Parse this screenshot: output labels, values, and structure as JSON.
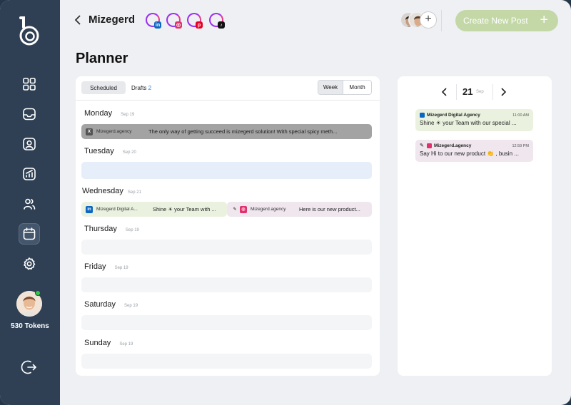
{
  "header": {
    "account_name": "Mizegerd",
    "socials": [
      {
        "icon": "linkedin-icon",
        "color": "#0a66c2",
        "glyph": "in"
      },
      {
        "icon": "instagram-icon",
        "color": "#e1306c",
        "glyph": "◎"
      },
      {
        "icon": "pinterest-icon",
        "color": "#e60023",
        "glyph": "p"
      },
      {
        "icon": "tiktok-icon",
        "color": "#111111",
        "glyph": "♪"
      }
    ],
    "create_button": "Create New Post",
    "create_plus": "+",
    "team_plus": "+"
  },
  "sidebar": {
    "tokens": "530 Tokens",
    "items": [
      "dashboard",
      "inbox",
      "profile",
      "analytics",
      "team",
      "planner",
      "settings"
    ],
    "active": "planner"
  },
  "page": {
    "title": "Planner"
  },
  "planner": {
    "tabs": {
      "scheduled": "Scheduled",
      "drafts": "Drafts",
      "drafts_count": "2"
    },
    "view": {
      "week": "Week",
      "month": "Month",
      "selected": "Week"
    },
    "days": [
      {
        "name": "Monday",
        "date": "Sep 19"
      },
      {
        "name": "Tuesday",
        "date": "Sep 20"
      },
      {
        "name": "Wednesday",
        "date": "Sep 21"
      },
      {
        "name": "Thursday",
        "date": "Sep 19"
      },
      {
        "name": "Friday",
        "date": "Sep 19"
      },
      {
        "name": "Saturday",
        "date": "Sep 19"
      },
      {
        "name": "Sunday",
        "date": "Sep 19"
      }
    ],
    "posts": {
      "monday": {
        "icon": "x-icon",
        "account": "Mizegerd.agency",
        "text": "The only way of getting succeed is mizegerd solution! With special spicy meth..."
      },
      "wed1": {
        "icon": "linkedin-icon",
        "account": "Mizegerd Digital A...",
        "text": "Shine ☀ your Team with ..."
      },
      "wed2": {
        "icon": "instagram-icon",
        "account": "Mizegerd.agency",
        "text": "Here is our new product..."
      }
    }
  },
  "calendar": {
    "day": "21",
    "month": "Sep",
    "events": [
      {
        "account": "Mizegerd Digital Agency",
        "time": "11:00 AM",
        "text": "Shine ☀ your Team with our special ..."
      },
      {
        "account": "Mizegerd.agency",
        "time": "12:59 PM",
        "text": "Say Hi to our new product 👏 , busin ..."
      }
    ]
  }
}
